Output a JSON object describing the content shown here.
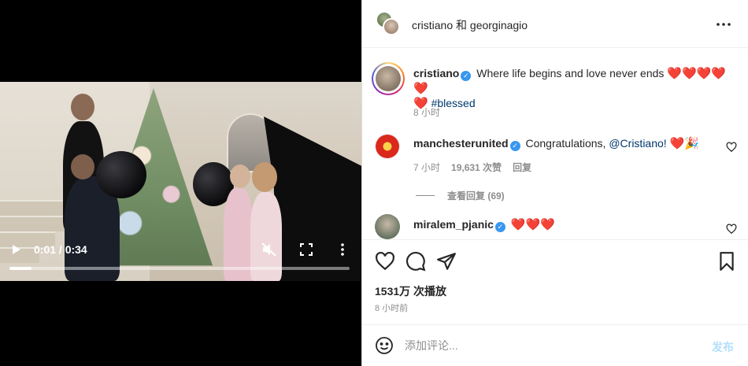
{
  "video": {
    "time": "0:01 / 0:34",
    "progress": 0.065,
    "icons": {
      "play": "play-icon",
      "mute": "volume-muted-icon",
      "fullscreen": "fullscreen-icon",
      "more": "more-vertical-icon"
    }
  },
  "header": {
    "title": "cristiano 和 georginagio",
    "more_icon": "more-horizontal-icon"
  },
  "caption": {
    "username": "cristiano",
    "text": "Where life begins and love never ends",
    "hearts": "❤️❤️❤️❤️❤️",
    "heart2": "❤️",
    "hashtag": "#blessed",
    "time": "8 小时"
  },
  "comments": [
    {
      "username": "manchesterunited",
      "text": "Congratulations,",
      "mention": "@Cristiano!",
      "emoji": "❤️🎉",
      "time": "7 小时",
      "likes": "19,631 次赞",
      "reply": "回复",
      "view_replies": "查看回复 (69)"
    },
    {
      "username": "miralem_pjanic",
      "emoji": "❤️❤️❤️"
    }
  ],
  "actions": {
    "views": "1531万 次播放",
    "time_ago": "8 小时前",
    "icons": [
      "heart-icon",
      "comment-icon",
      "share-icon",
      "bookmark-icon"
    ]
  },
  "add_comment": {
    "placeholder": "添加评论...",
    "post_label": "发布"
  },
  "colors": {
    "verified": "#3897f0",
    "heart": "#ed1d24",
    "link": "#00376b",
    "post_disabled": "#b2dffc"
  }
}
